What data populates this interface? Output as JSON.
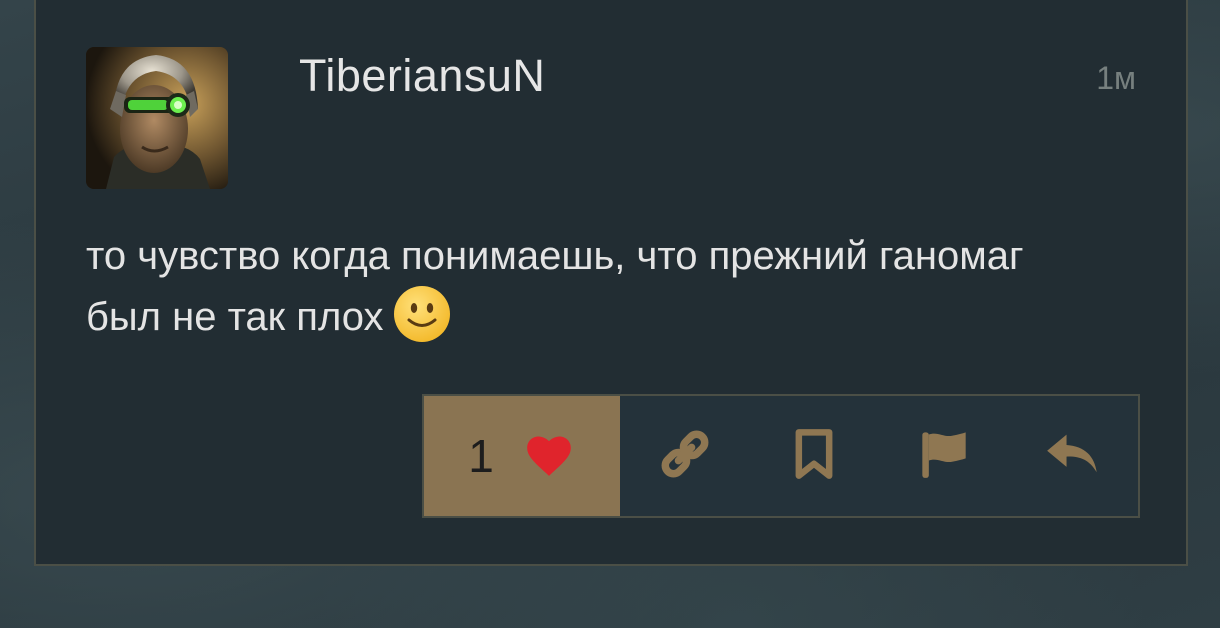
{
  "post": {
    "username": "TiberiansuN",
    "timestamp": "1м",
    "message": "то чувство когда понимаешь, что прежний ганомаг был не так плох",
    "likes": "1"
  },
  "icons": {
    "avatar": "soldier-with-green-eyepiece",
    "emoji": "slightly-smiling-face",
    "like": "heart-icon",
    "link": "link-icon",
    "bookmark": "bookmark-icon",
    "flag": "flag-icon",
    "reply": "reply-icon"
  },
  "colors": {
    "accent": "#8a7452",
    "icon": "#8f7752",
    "heart": "#e0242c",
    "panel": "#222d33",
    "border": "#4b4f46"
  }
}
